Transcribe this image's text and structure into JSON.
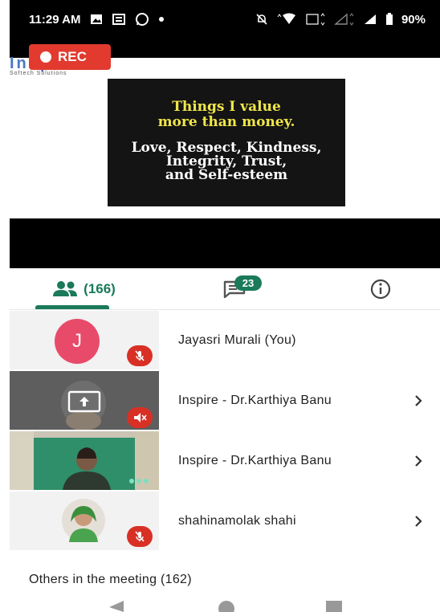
{
  "status_bar": {
    "time": "11:29 AM",
    "battery": "90%"
  },
  "recording": {
    "label": "REC"
  },
  "logo": {
    "brand": "Inspire",
    "tagline": "Softech Solutions"
  },
  "slide": {
    "heading_line1": "Things I value",
    "heading_line2": "more than money.",
    "body_line1": "Love, Respect, Kindness,",
    "body_line2": "Integrity, Trust,",
    "body_line3": "and Self-esteem"
  },
  "tabs": {
    "people_count": "(166)",
    "chat_badge": "23"
  },
  "participants": [
    {
      "name": "Jayasri Murali (You)",
      "avatar_letter": "J"
    },
    {
      "name": "Inspire - Dr.Karthiya Banu"
    },
    {
      "name": "Inspire - Dr.Karthiya Banu"
    },
    {
      "name": "shahinamolak shahi"
    }
  ],
  "others_label": "Others in the meeting (162)",
  "colors": {
    "accent": "#1a7a5a",
    "rec": "#e23a2e",
    "mute": "#d93025",
    "avatar": "#e84b6a"
  }
}
